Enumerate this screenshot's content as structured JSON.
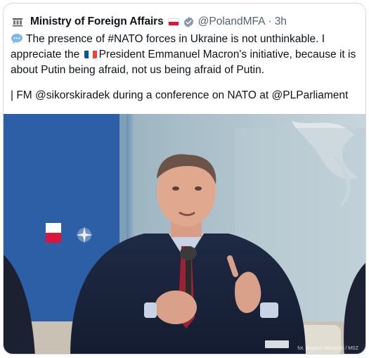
{
  "tweet": {
    "account_name": "Ministry of Foreign Affairs",
    "handle": "@PolandMFA",
    "separator": "·",
    "time": "3h",
    "line1": "The presence of #NATO forces in Ukraine is not unthinkable. I appreciate the",
    "line1_cont": "President Emmanuel Macron's initiative, because it is about Putin being afraid, not us being afraid of Putin.",
    "line2": "| FM @sikorskiradek during a conference on NATO at @PLParliament",
    "photo_credit": "fot. Bogdan Mikowski / MSZ"
  },
  "icons": {
    "avatar": "poland-mfa-emblem-icon",
    "flag": "poland-flag-icon",
    "verified": "verified-badge-icon",
    "bubble": "speech-bubble-icon",
    "flag_fr": "france-flag-icon"
  },
  "colors": {
    "text": "#0f1419",
    "muted": "#536471",
    "verified_badge": "#829aab",
    "border": "#cfd9de"
  }
}
